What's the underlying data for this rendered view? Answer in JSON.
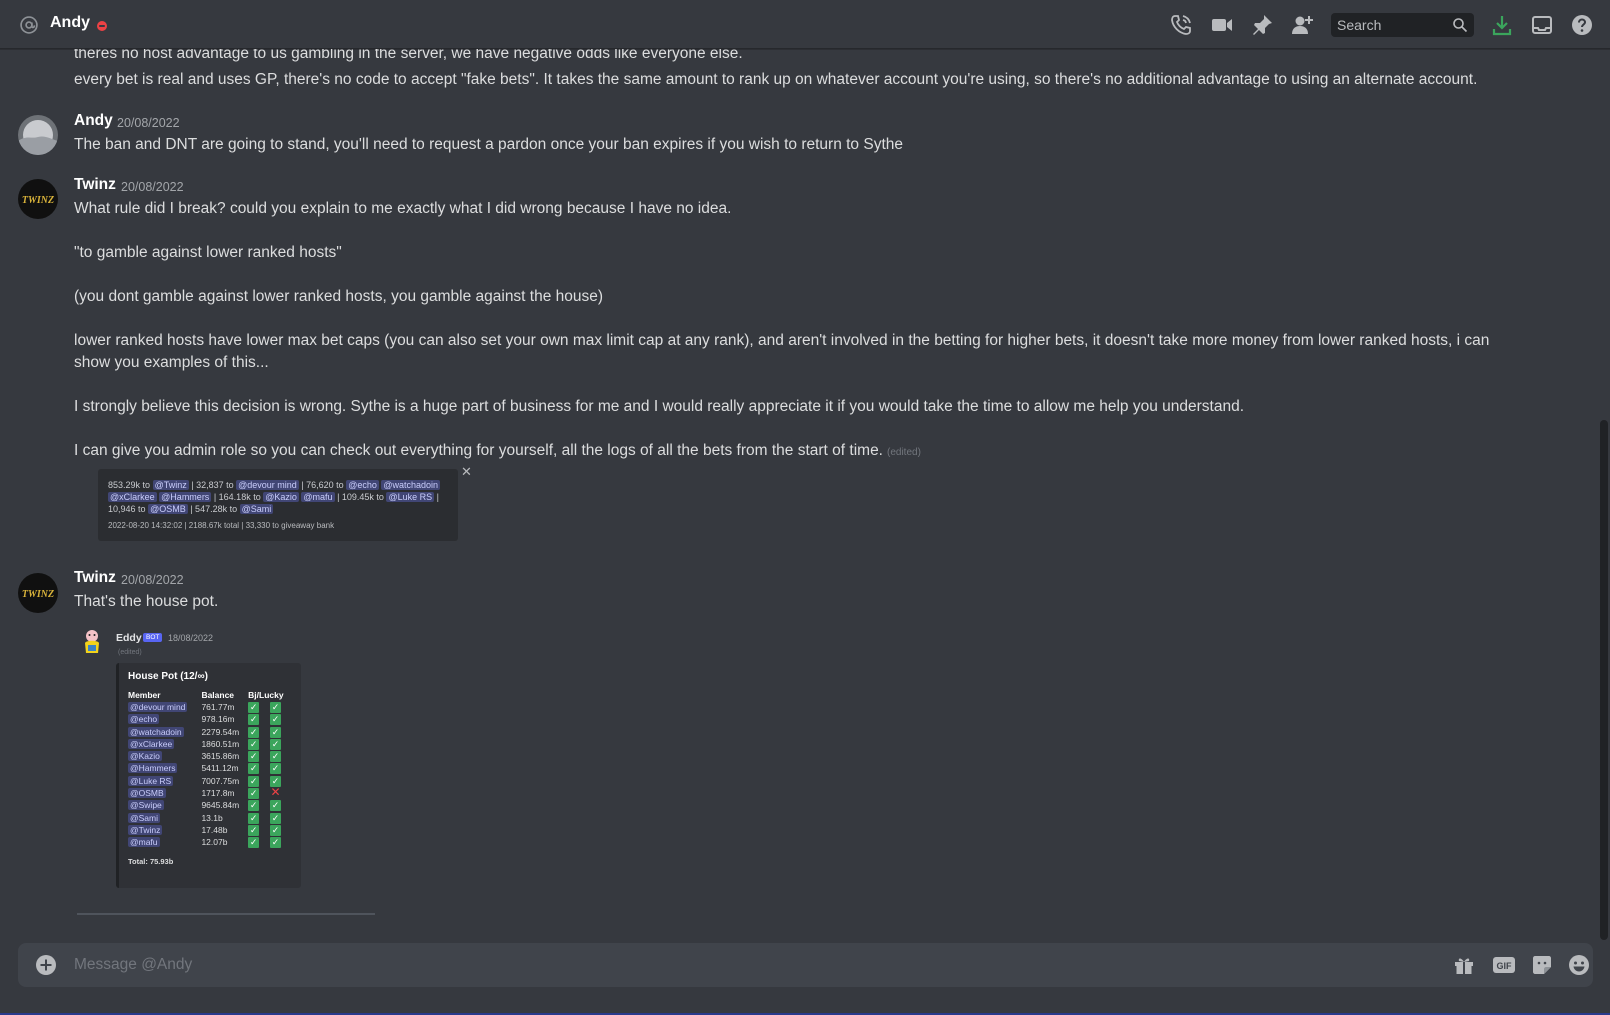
{
  "header": {
    "name": "Andy",
    "search_placeholder": "Search"
  },
  "messages": {
    "prev_line1": "theres no host advantage to us gambling in the server, we have negative odds like everyone else.",
    "prev_line2": "every bet is real and uses GP, there's no code to accept \"fake bets\". It takes the same amount to rank up on whatever account you're using, so there's no additional advantage to using an alternate account.",
    "m1": {
      "author": "Andy",
      "timestamp": "20/08/2022",
      "text": "The ban and DNT are going to stand, you'll need to request a pardon once your ban expires if you wish to return to Sythe"
    },
    "m2": {
      "author": "Twinz",
      "timestamp": "20/08/2022",
      "p1": "What rule did I break? could you explain to me exactly what I did wrong because I have no idea.",
      "p2": "\"to gamble against lower ranked hosts\"",
      "p3": "(you dont gamble against lower ranked hosts, you gamble against the house)",
      "p4": "lower ranked hosts have lower max bet caps (you can also set your own max limit cap at any rank), and aren't involved in the betting for higher bets, it doesn't take more money from lower ranked hosts, i can show you examples of this...",
      "p5": "I strongly believe this decision is wrong. Sythe is a huge part of business for me and I would really appreciate it if you would take the time to allow me help you understand.",
      "p6": "I can give you admin role so you can check out everything for yourself, all the logs of all the bets from the start of time.",
      "edited": "(edited)",
      "embed": {
        "t1": "853.29k to",
        "m_twinz": "@Twinz",
        "t2": "| 32,837 to",
        "m_devour": "@devour mind",
        "t3": "| 76,620 to",
        "m_echo": "@echo",
        "m_watchadoin": "@watchadoin",
        "m_xclarkee": "@xClarkee",
        "m_hammers": "@Hammers",
        "t4": "| 164.18k to",
        "m_kazio": "@Kazio",
        "m_mafu": "@mafu",
        "t5": "| 109.45k to",
        "m_luke": "@Luke RS",
        "t6": "|",
        "t7": "10,946 to",
        "m_osmb": "@OSMB",
        "t8": "| 547.28k to",
        "m_sami": "@Sami",
        "footer": "2022-08-20 14:32:02 | 2188.67k total | 33,330 to giveaway bank",
        "close": "✕"
      }
    },
    "m3": {
      "author": "Twinz",
      "timestamp": "20/08/2022",
      "text": "That's the house pot.",
      "quoted": {
        "author": "Eddy",
        "bot": "BOT",
        "timestamp": "18/08/2022",
        "edited": "(edited)",
        "title": "House Pot (12/∞)",
        "col_member": "Member",
        "col_balance": "Balance",
        "col_bj": "Bj/Lucky",
        "rows": [
          {
            "member": "@devour mind",
            "balance": "761.77m",
            "bj": true,
            "lucky": true
          },
          {
            "member": "@echo",
            "balance": "978.16m",
            "bj": true,
            "lucky": true
          },
          {
            "member": "@watchadoin",
            "balance": "2279.54m",
            "bj": true,
            "lucky": true
          },
          {
            "member": "@xClarkee",
            "balance": "1860.51m",
            "bj": true,
            "lucky": true
          },
          {
            "member": "@Kazio",
            "balance": "3615.86m",
            "bj": true,
            "lucky": true
          },
          {
            "member": "@Hammers",
            "balance": "5411.12m",
            "bj": true,
            "lucky": true
          },
          {
            "member": "@Luke RS",
            "balance": "7007.75m",
            "bj": true,
            "lucky": true
          },
          {
            "member": "@OSMB",
            "balance": "1717.8m",
            "bj": true,
            "lucky": false
          },
          {
            "member": "@Swipe",
            "balance": "9645.84m",
            "bj": true,
            "lucky": true
          },
          {
            "member": "@Sami",
            "balance": "13.1b",
            "bj": true,
            "lucky": true
          },
          {
            "member": "@Twinz",
            "balance": "17.48b",
            "bj": true,
            "lucky": true
          },
          {
            "member": "@mafu",
            "balance": "12.07b",
            "bj": true,
            "lucky": true
          }
        ],
        "total": "Total: 75.93b"
      }
    }
  },
  "composer": {
    "placeholder": "Message @Andy"
  },
  "colors": {
    "background": "#36393f",
    "header_text": "#ffffff",
    "dnd_status": "#ed4245",
    "download_green": "#3ba55c",
    "mention_bg": "#414675"
  },
  "icons": [
    "at-icon",
    "dnd-status-icon",
    "call-icon",
    "video-icon",
    "pin-icon",
    "add-friend-icon",
    "search-icon",
    "download-icon",
    "inbox-icon",
    "help-icon",
    "plus-icon",
    "gift-icon",
    "gif-icon",
    "sticker-icon",
    "emoji-icon"
  ]
}
